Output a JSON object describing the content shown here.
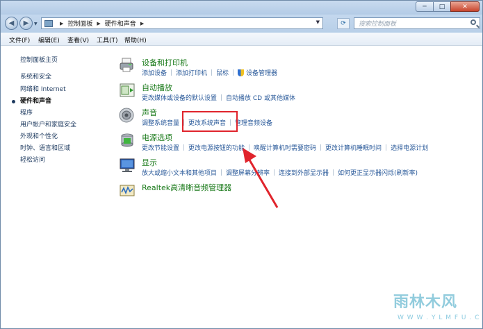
{
  "window": {
    "min_label": "─",
    "max_label": "□",
    "close_label": "✕"
  },
  "nav": {
    "back": "◀",
    "forward": "▶",
    "breadcrumbs": [
      "控制面板",
      "硬件和声音"
    ],
    "search_placeholder": "搜索控制面板"
  },
  "menu": [
    "文件(F)",
    "编辑(E)",
    "查看(V)",
    "工具(T)",
    "帮助(H)"
  ],
  "sidebar": {
    "items": [
      {
        "label": "控制面板主页"
      },
      {
        "label": "系统和安全"
      },
      {
        "label": "网络和 Internet"
      },
      {
        "label": "硬件和声音"
      },
      {
        "label": "程序"
      },
      {
        "label": "用户帐户和家庭安全"
      },
      {
        "label": "外观和个性化"
      },
      {
        "label": "时钟、语言和区域"
      },
      {
        "label": "轻松访问"
      }
    ]
  },
  "categories": [
    {
      "title": "设备和打印机",
      "icon": "printer-icon",
      "links": [
        "添加设备",
        "添加打印机",
        "鼠标",
        "设备管理器"
      ]
    },
    {
      "title": "自动播放",
      "icon": "autoplay-icon",
      "links": [
        "更改媒体或设备的默认设置",
        "自动播放 CD 或其他媒体"
      ]
    },
    {
      "title": "声音",
      "icon": "speaker-icon",
      "links": [
        "调整系统音量",
        "更改系统声音",
        "管理音频设备"
      ]
    },
    {
      "title": "电源选项",
      "icon": "power-icon",
      "links": [
        "更改节能设置",
        "更改电源按钮的功能",
        "唤醒计算机时需要密码",
        "更改计算机睡眠时间",
        "选择电源计划"
      ]
    },
    {
      "title": "显示",
      "icon": "display-icon",
      "links": [
        "放大或缩小文本和其他项目",
        "调整屏幕分辨率",
        "连接到外部显示器",
        "如何更正显示器闪烁(刷新率)"
      ]
    },
    {
      "title": "Realtek高清晰音频管理器",
      "icon": "realtek-icon",
      "links": []
    }
  ],
  "watermark": {
    "text": "雨林木风",
    "sub": "W W W . Y L M F U . C O M"
  },
  "colors": {
    "accent": "#2a5a9a",
    "category": "#1a7a1a",
    "highlight": "#e0242c"
  }
}
